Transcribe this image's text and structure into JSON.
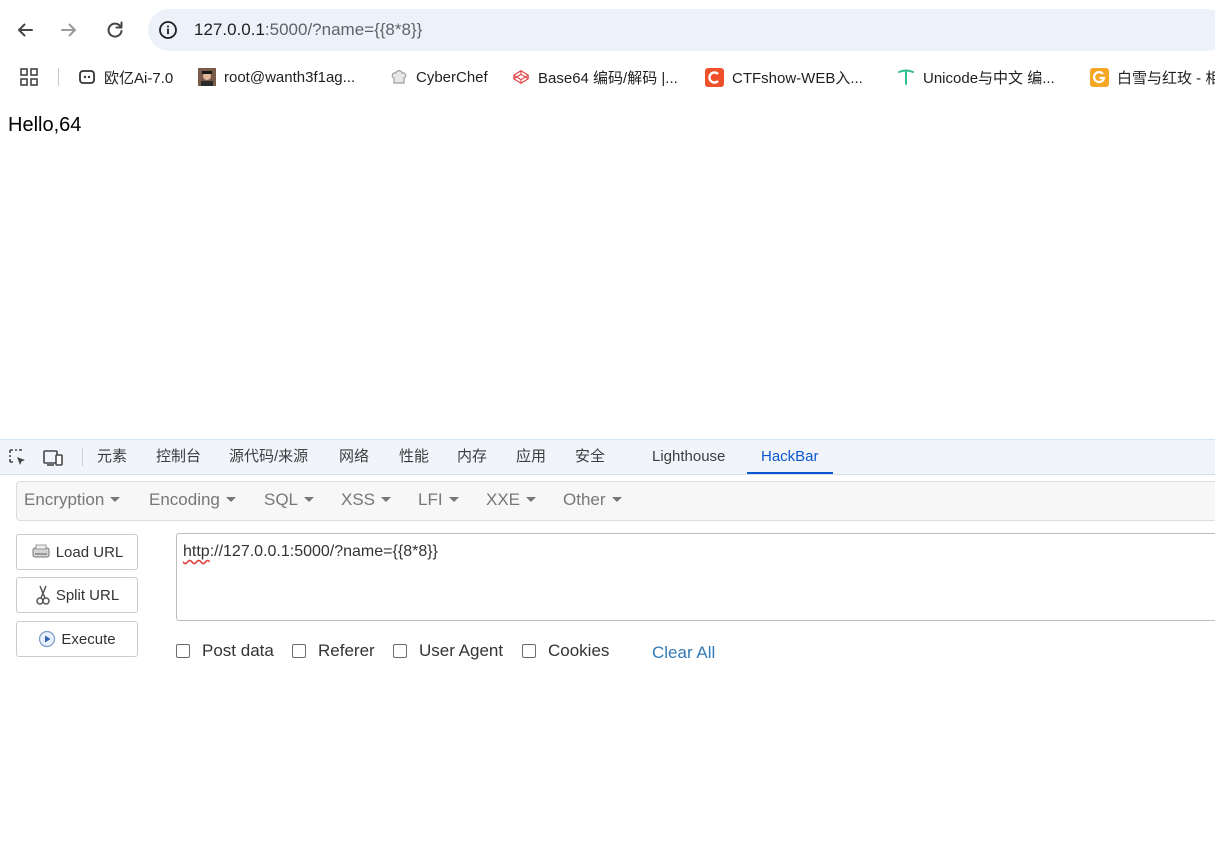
{
  "toolbar": {
    "back_icon": "arrow-left-icon",
    "forward_icon": "arrow-right-icon",
    "reload_icon": "reload-icon",
    "site_info_icon": "info-circle-icon",
    "url_host": "127.0.0.1",
    "url_rest": ":5000/?name={{8*8}}"
  },
  "bookmarks": [
    {
      "label": "欧亿Ai-7.0",
      "icon": "robot-icon",
      "color": "#333333"
    },
    {
      "label": "root@wanth3f1ag...",
      "icon": "avatar-photo-icon",
      "color": "#5b3a2a"
    },
    {
      "label": "CyberChef",
      "icon": "chef-hat-icon",
      "color": "#9e9e9e"
    },
    {
      "label": "Base64 编码/解码 |...",
      "icon": "codepen-icon",
      "color": "#e04848"
    },
    {
      "label": "CTFshow-WEB入...",
      "icon": "letter-c-icon",
      "color": "#f0502a"
    },
    {
      "label": "Unicode与中文 编...",
      "icon": "t-logo-icon",
      "color": "#2fbf8f"
    },
    {
      "label": "白雪与红玫 - 相",
      "icon": "letter-g-icon",
      "color": "#f5a623"
    }
  ],
  "page": {
    "body_text": "Hello,64"
  },
  "devtools": {
    "tabs": [
      "元素",
      "控制台",
      "源代码/来源",
      "网络",
      "性能",
      "内存",
      "应用",
      "安全",
      "Lighthouse",
      "HackBar"
    ],
    "active_tab": "HackBar",
    "accent": "#0b57d0"
  },
  "hackbar": {
    "menus": [
      "Encryption",
      "Encoding",
      "SQL",
      "XSS",
      "LFI",
      "XXE",
      "Other"
    ],
    "buttons": {
      "load_url": "Load URL",
      "split_url": "Split URL",
      "execute": "Execute"
    },
    "url_scheme": "http",
    "url_rest": "://127.0.0.1:5000/?name={{8*8}}",
    "checkboxes": [
      {
        "label": "Post data",
        "checked": false
      },
      {
        "label": "Referer",
        "checked": false
      },
      {
        "label": "User Agent",
        "checked": false
      },
      {
        "label": "Cookies",
        "checked": false
      }
    ],
    "clear_all": "Clear All",
    "link_color": "#337ab7"
  }
}
